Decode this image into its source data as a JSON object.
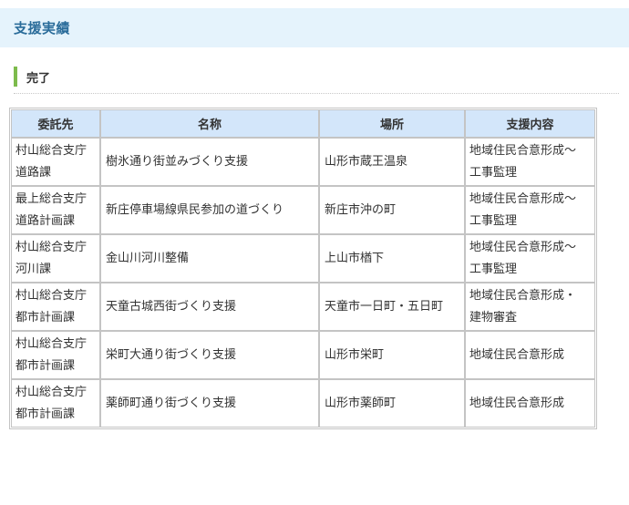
{
  "section": {
    "title": "支援実績"
  },
  "subsection": {
    "title": "完了"
  },
  "table": {
    "headers": [
      "委託先",
      "名称",
      "場所",
      "支援内容"
    ],
    "rows": [
      {
        "client": [
          "村山総合支庁",
          "道路課"
        ],
        "name": "樹氷通り街並みづくり支援",
        "location": "山形市蔵王温泉",
        "support": [
          "地域住民合意形成～",
          "工事監理"
        ]
      },
      {
        "client": [
          "最上総合支庁",
          "道路計画課"
        ],
        "name": "新庄停車場線県民参加の道づくり",
        "location": "新庄市沖の町",
        "support": [
          "地域住民合意形成～",
          "工事監理"
        ]
      },
      {
        "client": [
          "村山総合支庁",
          "河川課"
        ],
        "name": "金山川河川整備",
        "location": "上山市楢下",
        "support": [
          "地域住民合意形成～",
          "工事監理"
        ]
      },
      {
        "client": [
          "村山総合支庁",
          "都市計画課"
        ],
        "name": "天童古城西街づくり支援",
        "location": "天童市一日町・五日町",
        "support": [
          "地域住民合意形成・",
          "建物審査"
        ]
      },
      {
        "client": [
          "村山総合支庁",
          "都市計画課"
        ],
        "name": "栄町大通り街づくり支援",
        "location": "山形市栄町",
        "support": [
          "地域住民合意形成"
        ]
      },
      {
        "client": [
          "村山総合支庁",
          "都市計画課"
        ],
        "name": "薬師町通り街づくり支援",
        "location": "山形市薬師町",
        "support": [
          "地域住民合意形成"
        ]
      }
    ]
  }
}
